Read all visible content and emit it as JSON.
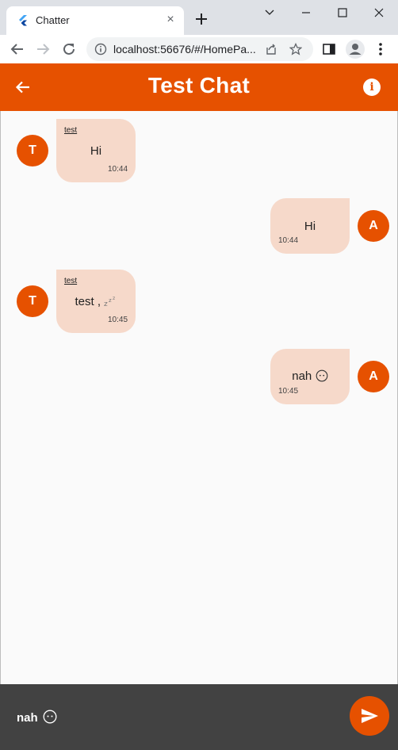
{
  "browser": {
    "tab_title": "Chatter",
    "url": "localhost:56676/#/HomePa..."
  },
  "app": {
    "title": "Test Chat"
  },
  "messages": [
    {
      "direction": "in",
      "sender": "test",
      "avatar_letter": "T",
      "text": "Hi",
      "time": "10:44"
    },
    {
      "direction": "out",
      "avatar_letter": "A",
      "text": "Hi",
      "time": "10:44"
    },
    {
      "direction": "in",
      "sender": "test",
      "avatar_letter": "T",
      "text": "test ,",
      "emoji": "sleeping-zzz",
      "time": "10:45"
    },
    {
      "direction": "out",
      "avatar_letter": "A",
      "text": "nah",
      "emoji": "neutral-face",
      "time": "10:45"
    }
  ],
  "composer": {
    "value": "nah",
    "emoji": "neutral-face"
  },
  "colors": {
    "primary": "#e65100",
    "bubble": "#f6d9ca",
    "composer": "#424242"
  }
}
